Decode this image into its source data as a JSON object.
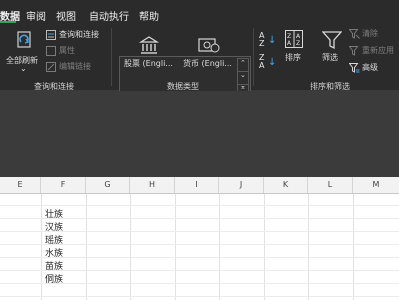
{
  "menu": {
    "items": [
      "数据",
      "审阅",
      "视图",
      "自动执行",
      "帮助"
    ]
  },
  "ribbon": {
    "get_data": {
      "refresh_all": "全部刷新",
      "queries_connections": "查询和连接",
      "properties": "属性",
      "edit_links": "编辑链接",
      "group_label": "查询和连接"
    },
    "data_types": {
      "stocks": "股票 (Engli...",
      "currencies": "货币 (Engli...",
      "group_label": "数据类型"
    },
    "sort_filter": {
      "sort": "排序",
      "filter": "筛选",
      "clear": "清除",
      "reapply": "重新应用",
      "advanced": "高级",
      "group_label": "排序和筛选"
    }
  },
  "sheet": {
    "columns": [
      "E",
      "F",
      "G",
      "H",
      "I",
      "J",
      "K",
      "L",
      "M"
    ],
    "cells_f": [
      "壮族",
      "汉族",
      "瑶族",
      "水族",
      "苗族",
      "侗族"
    ]
  }
}
